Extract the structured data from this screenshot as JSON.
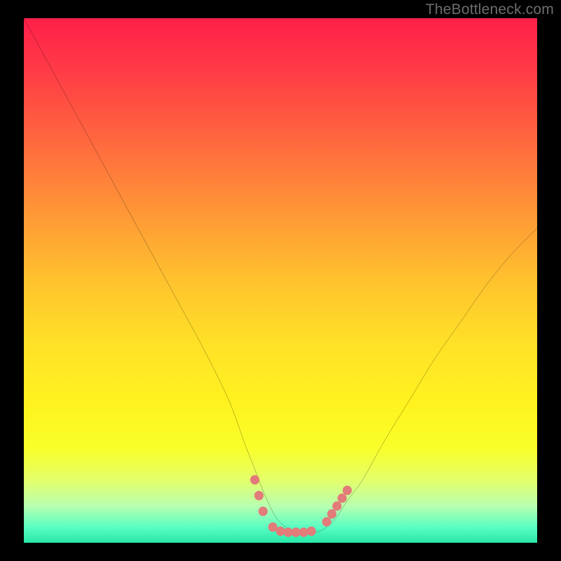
{
  "attribution": "TheBottleneck.com",
  "colors": {
    "page_bg": "#000000",
    "curve": "#000000",
    "marker": "#e27b79",
    "gradient_top": "#ff1f4a",
    "gradient_bottom": "#28e6a8"
  },
  "chart_data": {
    "type": "line",
    "title": "",
    "xlabel": "",
    "ylabel": "",
    "xlim": [
      0,
      100
    ],
    "ylim": [
      0,
      100
    ],
    "grid": false,
    "legend": false,
    "series": [
      {
        "name": "curve",
        "x": [
          0,
          5,
          10,
          15,
          20,
          25,
          30,
          35,
          40,
          43,
          45,
          47,
          49,
          51,
          53,
          55,
          57,
          59,
          61,
          63,
          66,
          70,
          75,
          80,
          85,
          90,
          95,
          100
        ],
        "y": [
          100,
          91,
          82,
          73,
          64,
          55,
          46,
          37,
          27,
          19,
          14,
          9,
          5,
          3,
          2,
          2,
          2,
          3,
          5,
          8,
          12,
          19,
          27,
          35,
          42,
          49,
          55,
          60
        ]
      }
    ],
    "markers": [
      {
        "x": 45.0,
        "y": 12.0
      },
      {
        "x": 45.8,
        "y": 9.0
      },
      {
        "x": 46.6,
        "y": 6.0
      },
      {
        "x": 48.5,
        "y": 3.0
      },
      {
        "x": 50.0,
        "y": 2.2
      },
      {
        "x": 51.5,
        "y": 2.0
      },
      {
        "x": 53.0,
        "y": 2.0
      },
      {
        "x": 54.5,
        "y": 2.0
      },
      {
        "x": 56.0,
        "y": 2.2
      },
      {
        "x": 59.0,
        "y": 4.0
      },
      {
        "x": 60.0,
        "y": 5.5
      },
      {
        "x": 61.0,
        "y": 7.0
      },
      {
        "x": 62.0,
        "y": 8.5
      },
      {
        "x": 63.0,
        "y": 10.0
      }
    ]
  }
}
